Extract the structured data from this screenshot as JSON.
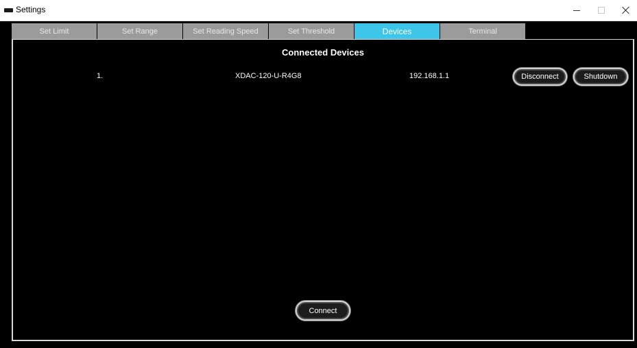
{
  "window": {
    "title": "Settings"
  },
  "tabs": [
    {
      "label": "Set Limit",
      "active": false
    },
    {
      "label": "Set Range",
      "active": false
    },
    {
      "label": "Set Reading Speed",
      "active": false
    },
    {
      "label": "Set Threshold",
      "active": false
    },
    {
      "label": "Devices",
      "active": true
    },
    {
      "label": "Terminal",
      "active": false
    }
  ],
  "devices": {
    "title": "Connected Devices",
    "rows": [
      {
        "index": "1.",
        "name": "XDAC-120-U-R4G8",
        "ip": "192.168.1.1",
        "disconnect_label": "Disconnect",
        "shutdown_label": "Shutdown"
      }
    ],
    "connect_label": "Connect"
  },
  "colors": {
    "active_tab": "#3ec6ea",
    "inactive_tab": "#9b9b9b",
    "background": "#000000"
  }
}
